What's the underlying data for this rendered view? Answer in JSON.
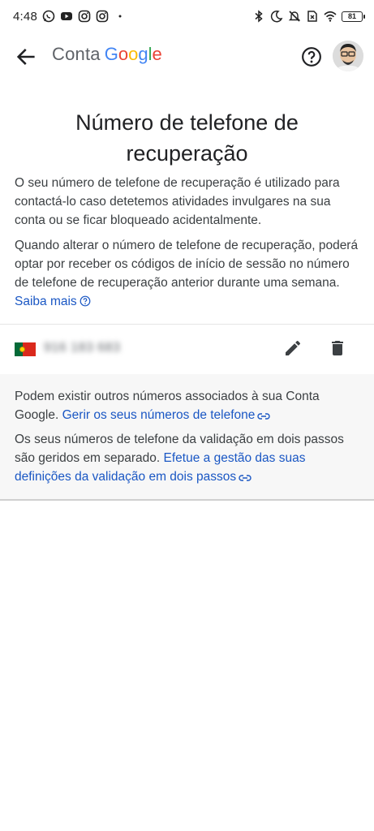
{
  "status_bar": {
    "time": "4:48",
    "battery": "81",
    "left_icons": [
      "whatsapp-icon",
      "youtube-icon",
      "instagram-icon",
      "instagram-icon",
      "dot-icon"
    ],
    "right_icons": [
      "bluetooth-icon",
      "moon-icon",
      "mute-icon",
      "no-sim-icon",
      "wifi-icon",
      "battery-icon"
    ]
  },
  "header": {
    "logo_text": "Conta",
    "google_letters": [
      "G",
      "o",
      "o",
      "g",
      "l",
      "e"
    ],
    "google_colors": [
      "#4285F4",
      "#EA4335",
      "#FBBC05",
      "#4285F4",
      "#34A853",
      "#EA4335"
    ]
  },
  "page": {
    "title": "Número de telefone de recuperação",
    "para1": "O seu número de telefone de recuperação é utilizado para contactá-lo caso detetemos atividades invulgares na sua conta ou se ficar bloqueado acidentalmente.",
    "para2": "Quando alterar o número de telefone de recuperação, poderá optar por receber os códigos de início de sessão no número de telefone de recuperação anterior durante uma semana.",
    "learn_more": "Saiba mais"
  },
  "phone": {
    "number": "916 183 683"
  },
  "info": {
    "text1": "Podem existir outros números associados à sua Conta Google.",
    "link1": "Gerir os seus números de telefone",
    "text2": "Os seus números de telefone da validação em dois passos são geridos em separado.",
    "link2": "Efetue a gestão das suas definições da validação em dois passos"
  },
  "colors": {
    "link": "#1a57c4",
    "text": "#3c4043",
    "title": "#202124"
  }
}
